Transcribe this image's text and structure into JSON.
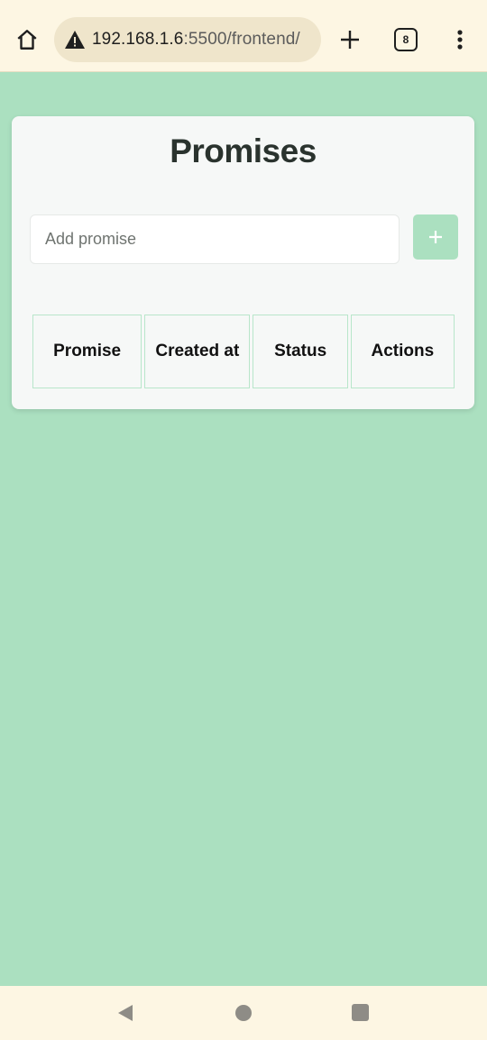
{
  "browser": {
    "url_host": "192.168.1.6",
    "url_path": ":5500/frontend/",
    "tab_count": "8",
    "icons": {
      "home": "home-icon",
      "warning": "warning-icon",
      "new_tab": "plus-icon",
      "menu": "more-vert-icon"
    }
  },
  "page": {
    "title": "Promises",
    "input_placeholder": "Add promise",
    "add_button_label": "+",
    "table_headers": [
      "Promise",
      "Created at",
      "Status",
      "Actions"
    ]
  },
  "colors": {
    "background": "#abe0c0",
    "card": "#f6f8f7",
    "accent": "#abe0c0",
    "browser_bar": "#fdf6e3"
  },
  "nav": {
    "icons": [
      "back-icon",
      "home-circle-icon",
      "recents-icon"
    ]
  }
}
